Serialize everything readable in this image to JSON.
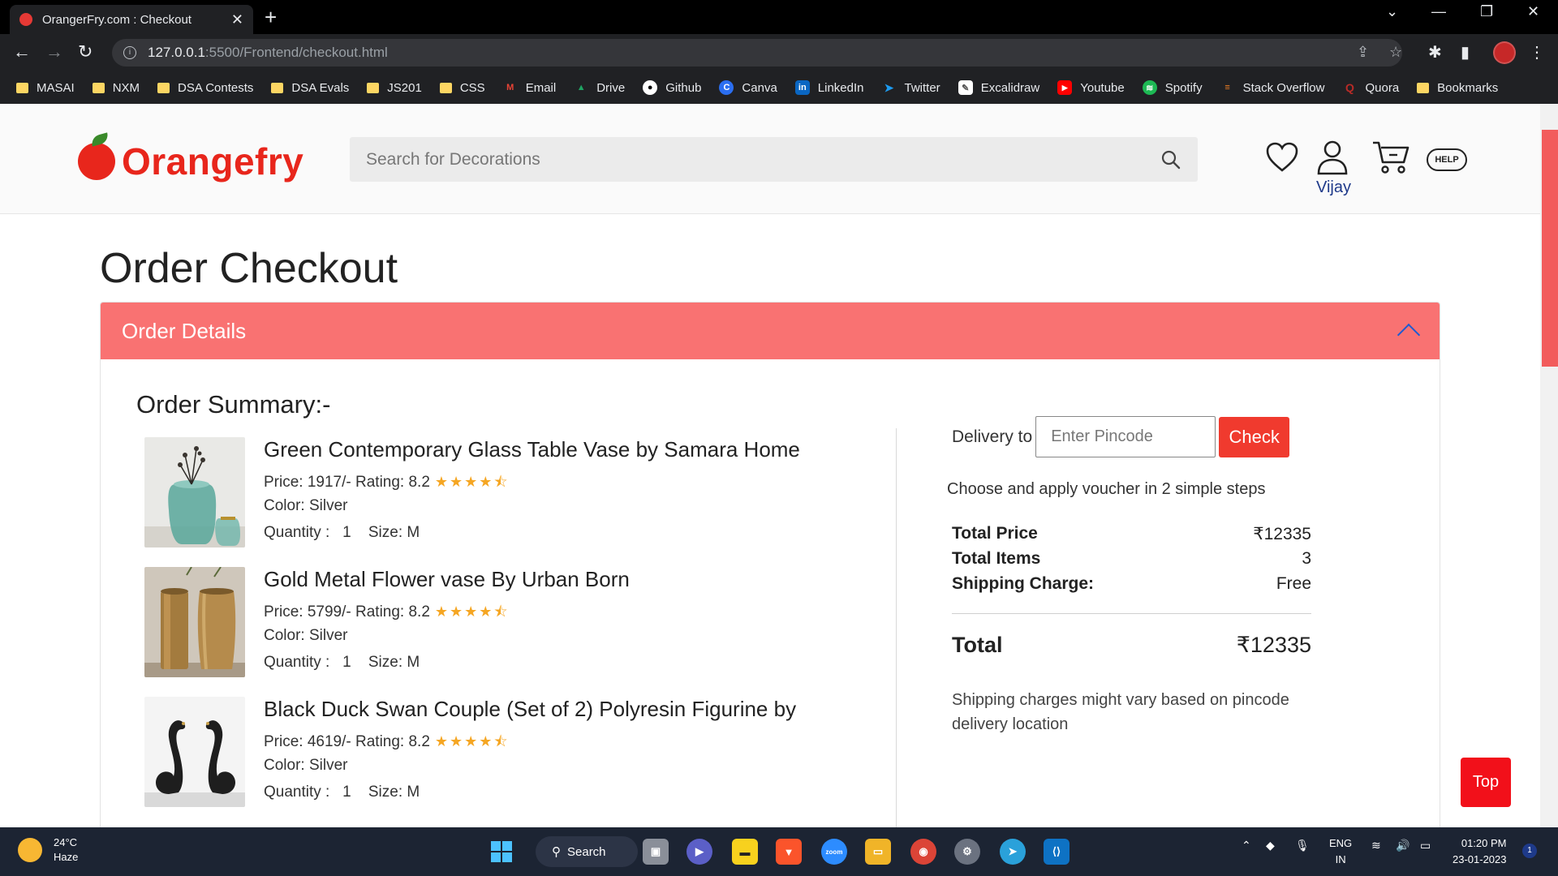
{
  "browser": {
    "tab_title": "OrangerFry.com : Checkout",
    "url_host": "127.0.0.1",
    "url_path": ":5500/Frontend/checkout.html",
    "bookmarks": [
      {
        "label": "MASAI",
        "icon": "folder-icon",
        "color": "#fdd663"
      },
      {
        "label": "NXM",
        "icon": "folder-icon",
        "color": "#fdd663"
      },
      {
        "label": "DSA Contests",
        "icon": "folder-icon",
        "color": "#fdd663"
      },
      {
        "label": "DSA Evals",
        "icon": "folder-icon",
        "color": "#fdd663"
      },
      {
        "label": "JS201",
        "icon": "folder-icon",
        "color": "#fdd663"
      },
      {
        "label": "CSS",
        "icon": "folder-icon",
        "color": "#fdd663"
      },
      {
        "label": "Email",
        "icon": "gmail-icon",
        "color": "#ea4335"
      },
      {
        "label": "Drive",
        "icon": "drive-icon",
        "color": "#1fa463"
      },
      {
        "label": "Github",
        "icon": "github-icon",
        "color": "#ffffff"
      },
      {
        "label": "Canva",
        "icon": "canva-icon",
        "color": "#2b6ef0"
      },
      {
        "label": "LinkedIn",
        "icon": "linkedin-icon",
        "color": "#0a66c2"
      },
      {
        "label": "Twitter",
        "icon": "twitter-icon",
        "color": "#1d9bf0"
      },
      {
        "label": "Excalidraw",
        "icon": "excalidraw-icon",
        "color": "#ffffff"
      },
      {
        "label": "Youtube",
        "icon": "youtube-icon",
        "color": "#ff0000"
      },
      {
        "label": "Spotify",
        "icon": "spotify-icon",
        "color": "#1db954"
      },
      {
        "label": "Stack Overflow",
        "icon": "stackoverflow-icon",
        "color": "#f48024"
      },
      {
        "label": "Quora",
        "icon": "quora-icon",
        "color": "#b92b27"
      },
      {
        "label": "Bookmarks",
        "icon": "folder-icon",
        "color": "#fdd663"
      }
    ]
  },
  "header": {
    "logo_text": "Orangefry",
    "search_placeholder": "Search for Decorations",
    "user_name": "Vijay",
    "help_label": "HELP"
  },
  "page": {
    "title": "Order Checkout",
    "panel_title": "Order Details",
    "summary_title": "Order Summary:-"
  },
  "products": [
    {
      "name": "Green Contemporary Glass Table Vase by Samara Home",
      "price_text": "Price: 1917/- Rating: 8.2",
      "rating_stars": 4.5,
      "color_text": "Color: Silver",
      "quantity_label": "Quantity :",
      "quantity": "1",
      "size_text": "Size: M"
    },
    {
      "name": "Gold Metal Flower vase By Urban Born",
      "price_text": "Price: 5799/- Rating: 8.2",
      "rating_stars": 4.5,
      "color_text": "Color: Silver",
      "quantity_label": "Quantity :",
      "quantity": "1",
      "size_text": "Size: M"
    },
    {
      "name": "Black Duck Swan Couple (Set of 2) Polyresin Figurine by",
      "price_text": "Price: 4619/- Rating: 8.2",
      "rating_stars": 4.5,
      "color_text": "Color: Silver",
      "quantity_label": "Quantity :",
      "quantity": "1",
      "size_text": "Size: M"
    }
  ],
  "summary": {
    "delivery_label": "Delivery to",
    "pincode_placeholder": "Enter Pincode",
    "check_label": "Check",
    "voucher_text": "Choose and apply voucher in 2 simple steps",
    "total_price_label": "Total Price",
    "total_price_value": "₹12335",
    "total_items_label": "Total Items",
    "total_items_value": "3",
    "shipping_label": "Shipping Charge:",
    "shipping_value": "Free",
    "total_label": "Total",
    "total_value": "₹12335",
    "note": "Shipping charges might vary based on pincode delivery location",
    "top_label": "Top"
  },
  "colors": {
    "brand": "#e8261c",
    "panel_header": "#f97272",
    "check_button": "#f03a2e",
    "top_button": "#f2101a"
  },
  "taskbar": {
    "temperature": "24°C",
    "weather": "Haze",
    "search_label": "Search",
    "language": "ENG",
    "region": "IN",
    "time": "01:20 PM",
    "date": "23-01-2023"
  }
}
